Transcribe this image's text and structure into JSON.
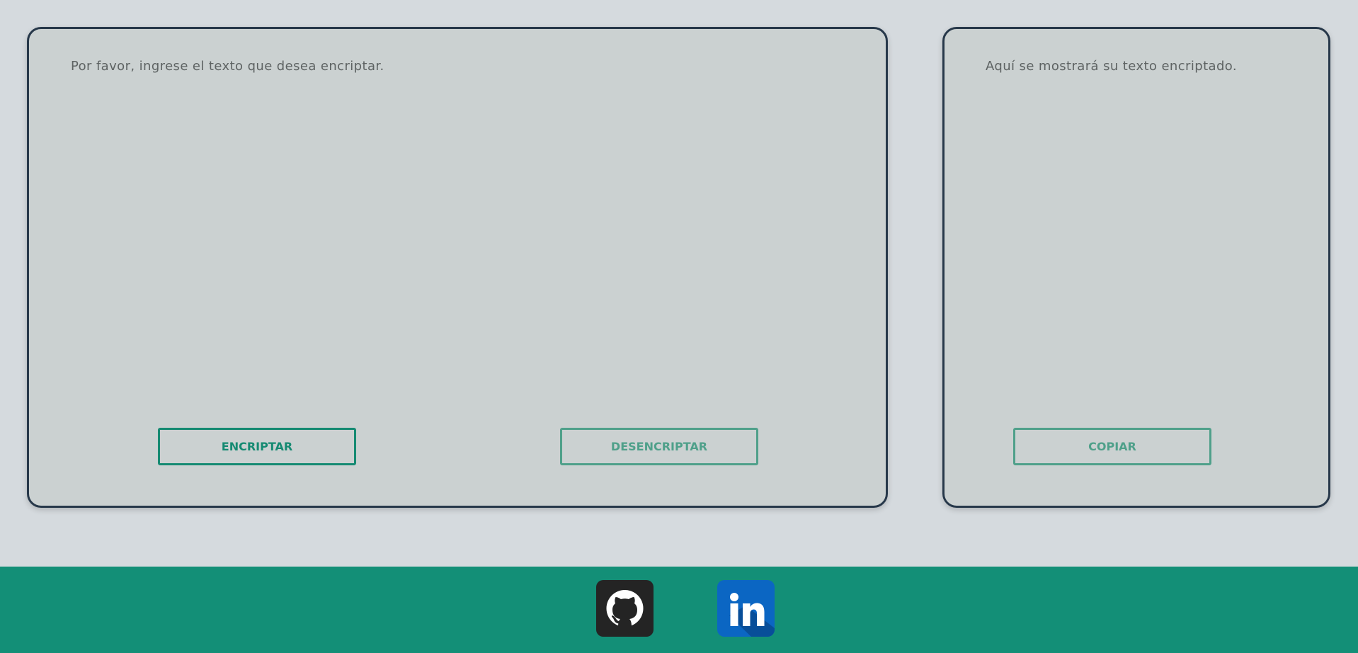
{
  "encryptor": {
    "input_placeholder": "Por favor, ingrese el texto que desea encriptar.",
    "encrypt_label": "ENCRIPTAR",
    "decrypt_label": "DESENCRIPTAR"
  },
  "result": {
    "output_placeholder": "Aquí se mostrará su texto encriptado.",
    "copy_label": "COPIAR"
  },
  "footer": {
    "links": [
      {
        "icon": "github-icon"
      },
      {
        "icon": "linkedin-icon"
      }
    ]
  },
  "colors": {
    "accent": "#138f77",
    "panel_border": "#27384a",
    "background": "#d5dade",
    "panel_background": "#cbd1d1"
  }
}
